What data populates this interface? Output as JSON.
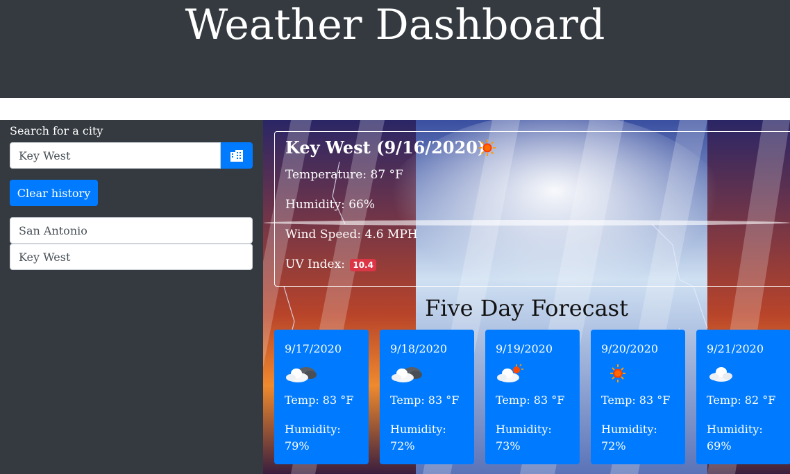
{
  "header": {
    "title": "Weather Dashboard"
  },
  "sidebar": {
    "search_label": "Search for a city",
    "search_value": "Key West",
    "clear_label": "Clear history",
    "history": [
      "San Antonio",
      "Key West"
    ]
  },
  "current": {
    "city_date": "Key West (9/16/2020)",
    "icon": "sun-icon",
    "temperature": "Temperature: 87 °F",
    "humidity": "Humidity: 66%",
    "wind": "Wind Speed: 4.6 MPH",
    "uv_label": "UV Index:",
    "uv_value": "10.4"
  },
  "forecast": {
    "title": "Five Day Forecast",
    "days": [
      {
        "date": "9/17/2020",
        "icon": "cloudy-icon",
        "temp": "Temp: 83 °F",
        "humidity_label": "Humidity:",
        "humidity": "79%"
      },
      {
        "date": "9/18/2020",
        "icon": "cloudy-icon",
        "temp": "Temp: 83 °F",
        "humidity_label": "Humidity:",
        "humidity": "72%"
      },
      {
        "date": "9/19/2020",
        "icon": "partly-sunny-icon",
        "temp": "Temp: 83 °F",
        "humidity_label": "Humidity:",
        "humidity": "73%"
      },
      {
        "date": "9/20/2020",
        "icon": "sun-icon",
        "temp": "Temp: 83 °F",
        "humidity_label": "Humidity:",
        "humidity": "72%"
      },
      {
        "date": "9/21/2020",
        "icon": "cloud-icon",
        "temp": "Temp: 82 °F",
        "humidity_label": "Humidity:",
        "humidity": "69%"
      }
    ]
  },
  "colors": {
    "header_bg": "#343a40",
    "primary": "#007bff",
    "danger": "#dc3545"
  }
}
